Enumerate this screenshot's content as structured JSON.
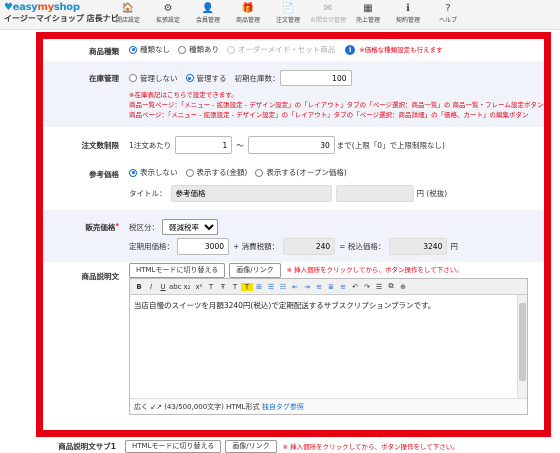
{
  "header": {
    "logo_main_a": "easy",
    "logo_main_b": "my",
    "logo_main_c": "shop",
    "shop_name": "イージーマイショップ 店長ナビ",
    "nav": [
      {
        "icon": "🏠",
        "label": "開店設定",
        "dim": false
      },
      {
        "icon": "⚙",
        "label": "拡張設定",
        "dim": false
      },
      {
        "icon": "👤",
        "label": "会員管理",
        "dim": false
      },
      {
        "icon": "🎁",
        "label": "商品管理",
        "dim": false
      },
      {
        "icon": "📄",
        "label": "注文管理",
        "dim": false
      },
      {
        "icon": "✉",
        "label": "お問合せ管理",
        "dim": true
      },
      {
        "icon": "▦",
        "label": "売上管理",
        "dim": false
      },
      {
        "icon": "ℹ",
        "label": "契約管理",
        "dim": false
      },
      {
        "icon": "?",
        "label": "ヘルプ",
        "dim": false
      }
    ]
  },
  "form": {
    "variant": {
      "label": "商品種類",
      "options": [
        "種類なし",
        "種類あり",
        "オーダーメイド・セット商品"
      ],
      "selected": 0,
      "note": "※価格な種類設定も行えます"
    },
    "stock": {
      "label": "在庫管理",
      "options": [
        "管理しない",
        "管理する"
      ],
      "selected": 1,
      "initial_label": "初期在庫数：",
      "initial_value": "100",
      "note1": "※在庫表記はこちらで設定できます。",
      "note2": "商品一覧ページ：「メニュー - 拡張設定 - デザイン設定」の「レイアウト」タブの「ページ選択：商品一覧」の 商品一覧・フレーム設定ボタン",
      "note3": "商品ページ：「メニュー - 拡張設定 - デザイン設定」の「レイアウト」タブの「ページ選択：商品詳細」の「価格、カート」の編集ボタン"
    },
    "order_limit": {
      "label": "注文数制限",
      "prefix": "1注文あたり",
      "min": "1",
      "tilde": "〜",
      "max": "30",
      "suffix": "まで(上限「0」で上限制限なし)"
    },
    "ref_price": {
      "label": "参考価格",
      "options": [
        "表示しない",
        "表示する(金額)",
        "表示する(オープン価格)"
      ],
      "selected": 0,
      "title_label": "タイトル：",
      "title_value": "参考価格",
      "unit": "円 (税抜)"
    },
    "price": {
      "label": "販売価格",
      "required_mark": "*",
      "tax_label": "税区分：",
      "tax_value": "軽減税率",
      "regular_label": "定期用価格：",
      "regular_value": "3000",
      "plus": "+ 消費税額：",
      "tax_amount": "240",
      "eq": "= 税込価格：",
      "total": "3240",
      "yen": "円"
    },
    "description": {
      "label": "商品説明文",
      "html_button": "HTMLモードに切り替える",
      "image_button": "画像/リンク",
      "hint": "※ 挿入個所をクリックしてから、ボタン操作をして下さい。",
      "text": "当店自慢のスイーツを月額3240円(税込)で定期配送するサブスクリプションプランです。",
      "footer_expand": "広く",
      "footer_count": "(43/500,000文字) HTML形式",
      "footer_link": "独自タグ参照"
    },
    "description2": {
      "label": "商品説明文サブ1",
      "html_button": "HTMLモードに切り替える",
      "image_button": "画像/リンク",
      "hint": "※ 挿入個所をクリックしてから、ボタン操作をして下さい。"
    }
  },
  "toolbar_icons": [
    "B",
    "I",
    "U",
    "abc",
    "x₂",
    "x²",
    "T",
    "Ŧ",
    "T",
    "T",
    "⊞",
    "☰",
    "☷",
    "⇤",
    "⇥",
    "≡",
    "≣",
    "≡",
    "↶",
    "↷",
    "☰",
    "⧉",
    "⊕"
  ]
}
